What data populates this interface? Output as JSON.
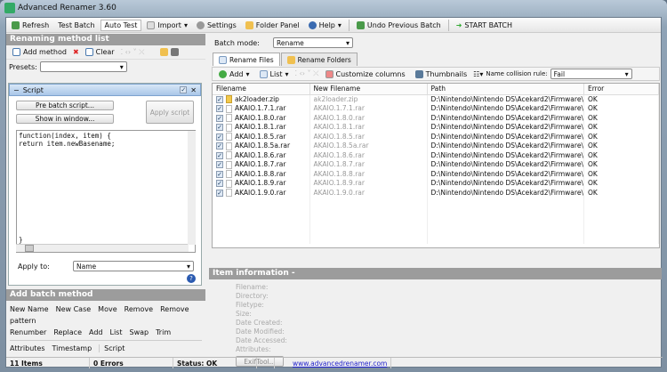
{
  "window": {
    "title": "Advanced Renamer 3.60"
  },
  "toolbar": {
    "refresh": "Refresh",
    "test_batch": "Test Batch",
    "auto_test": "Auto Test",
    "import": "Import",
    "settings": "Settings",
    "folder_panel": "Folder Panel",
    "help": "Help",
    "undo": "Undo Previous Batch",
    "start": "START BATCH"
  },
  "left": {
    "header": "Renaming method list",
    "add_method": "Add method",
    "clear": "Clear",
    "presets_label": "Presets:",
    "presets_value": "",
    "script": {
      "title": "Script",
      "pre_batch": "Pre batch script...",
      "show_window": "Show in window...",
      "apply_script": "Apply script",
      "code": "function(index, item) {\nreturn item.newBasename;\n\n\n\n\n\n\n\n\n\n\n\n}",
      "apply_to_label": "Apply to:",
      "apply_to_value": "Name"
    },
    "add_batch_header": "Add batch method",
    "methods_row1": [
      "New Name",
      "New Case",
      "Move",
      "Remove",
      "Remove pattern"
    ],
    "methods_row2": [
      "Renumber",
      "Replace",
      "Add",
      "List",
      "Swap",
      "Trim"
    ],
    "methods_row3": [
      "Attributes",
      "Timestamp",
      "Script"
    ]
  },
  "right": {
    "batch_mode_label": "Batch mode:",
    "batch_mode_value": "Rename",
    "tabs": [
      "Rename Files",
      "Rename Folders"
    ],
    "add": "Add",
    "list": "List",
    "customize": "Customize columns",
    "thumbnails": "Thumbnails",
    "collision_label": "Name collision rule:",
    "collision_value": "Fail",
    "columns": [
      "Filename",
      "New Filename",
      "Path",
      "Error"
    ],
    "rows": [
      {
        "name": "ak2loader.zip",
        "new": "ak2loader.zip",
        "path": "D:\\Nintendo\\Nintendo DS\\Acekard2\\Firmware\\",
        "error": "OK",
        "zip": true
      },
      {
        "name": "AKAIO.1.7.1.rar",
        "new": "AKAIO.1.7.1.rar",
        "path": "D:\\Nintendo\\Nintendo DS\\Acekard2\\Firmware\\",
        "error": "OK"
      },
      {
        "name": "AKAIO.1.8.0.rar",
        "new": "AKAIO.1.8.0.rar",
        "path": "D:\\Nintendo\\Nintendo DS\\Acekard2\\Firmware\\",
        "error": "OK"
      },
      {
        "name": "AKAIO.1.8.1.rar",
        "new": "AKAIO.1.8.1.rar",
        "path": "D:\\Nintendo\\Nintendo DS\\Acekard2\\Firmware\\",
        "error": "OK"
      },
      {
        "name": "AKAIO.1.8.5.rar",
        "new": "AKAIO.1.8.5.rar",
        "path": "D:\\Nintendo\\Nintendo DS\\Acekard2\\Firmware\\",
        "error": "OK"
      },
      {
        "name": "AKAIO.1.8.5a.rar",
        "new": "AKAIO.1.8.5a.rar",
        "path": "D:\\Nintendo\\Nintendo DS\\Acekard2\\Firmware\\",
        "error": "OK"
      },
      {
        "name": "AKAIO.1.8.6.rar",
        "new": "AKAIO.1.8.6.rar",
        "path": "D:\\Nintendo\\Nintendo DS\\Acekard2\\Firmware\\",
        "error": "OK"
      },
      {
        "name": "AKAIO.1.8.7.rar",
        "new": "AKAIO.1.8.7.rar",
        "path": "D:\\Nintendo\\Nintendo DS\\Acekard2\\Firmware\\",
        "error": "OK"
      },
      {
        "name": "AKAIO.1.8.8.rar",
        "new": "AKAIO.1.8.8.rar",
        "path": "D:\\Nintendo\\Nintendo DS\\Acekard2\\Firmware\\",
        "error": "OK"
      },
      {
        "name": "AKAIO.1.8.9.rar",
        "new": "AKAIO.1.8.9.rar",
        "path": "D:\\Nintendo\\Nintendo DS\\Acekard2\\Firmware\\",
        "error": "OK"
      },
      {
        "name": "AKAIO.1.9.0.rar",
        "new": "AKAIO.1.9.0.rar",
        "path": "D:\\Nintendo\\Nintendo DS\\Acekard2\\Firmware\\",
        "error": "OK"
      }
    ],
    "info_header": "Item information -",
    "info_labels": [
      "Filename:",
      "Directory:",
      "Filetype:",
      "Size:",
      "Date Created:",
      "Date Modified:",
      "Date Accessed:",
      "Attributes:"
    ],
    "exiftool": "ExifTool..."
  },
  "status": {
    "items": "11 Items",
    "errors": "0 Errors",
    "status": "Status: OK",
    "link": "www.advancedrenamer.com"
  }
}
